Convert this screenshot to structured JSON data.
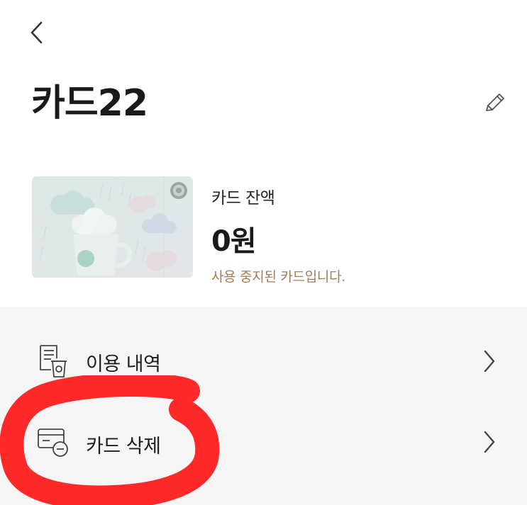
{
  "header": {
    "back_icon": "chevron-left-icon",
    "title": "카드22",
    "edit_icon": "pencil-icon"
  },
  "card": {
    "image_desc_icon": "starbucks-card-image",
    "balance_label": "카드 잔액",
    "balance_value": "0원",
    "status": "사용 중지된 카드입니다."
  },
  "menu": {
    "items": [
      {
        "label": "이용 내역",
        "icon": "receipt-cup-icon"
      },
      {
        "label": "카드 삭제",
        "icon": "card-delete-icon"
      }
    ]
  },
  "colors": {
    "status_text": "#a47c55",
    "menu_background": "#f5f5f5",
    "highlight": "#ff1e1e"
  }
}
